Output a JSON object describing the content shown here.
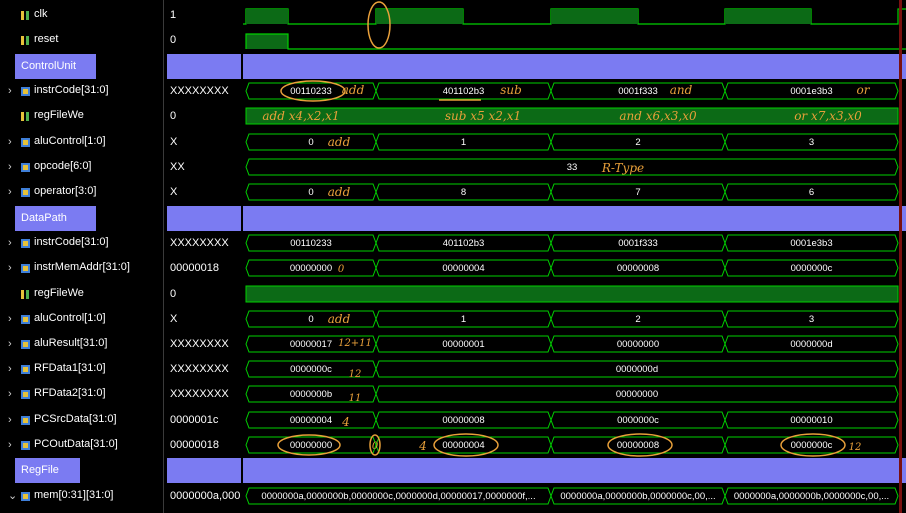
{
  "groups": {
    "control": "ControlUnit",
    "datapath": "DataPath",
    "regfile": "RegFile"
  },
  "signals": {
    "clk": "clk",
    "reset": "reset",
    "cu_instr": "instrCode[31:0]",
    "cu_regwe": "regFileWe",
    "cu_alu": "aluControl[1:0]",
    "cu_opcode": "opcode[6:0]",
    "cu_operator": "operator[3:0]",
    "dp_instr": "instrCode[31:0]",
    "dp_imem": "instrMemAddr[31:0]",
    "dp_regwe": "regFileWe",
    "dp_alu": "aluControl[1:0]",
    "dp_alures": "aluResult[31:0]",
    "dp_rf1": "RFData1[31:0]",
    "dp_rf2": "RFData2[31:0]",
    "dp_pcsrc": "PCSrcData[31:0]",
    "dp_pcout": "PCOutData[31:0]",
    "rf_mem": "mem[0:31][31:0]"
  },
  "values": {
    "clk": "1",
    "reset": "0",
    "cu_instr": "XXXXXXXX",
    "cu_regwe": "0",
    "cu_alu": "X",
    "cu_opcode": "XX",
    "cu_operator": "X",
    "dp_instr": "XXXXXXXX",
    "dp_imem": "00000018",
    "dp_regwe": "0",
    "dp_alu": "X",
    "dp_alures": "XXXXXXXX",
    "dp_rf1": "XXXXXXXX",
    "dp_rf2": "XXXXXXXX",
    "dp_pcsrc": "0000001c",
    "dp_pcout": "00000018",
    "rf_mem": "0000000a,000"
  },
  "wave": {
    "cu_instr": [
      "00110233",
      "401102b3",
      "0001f333",
      "0001e3b3"
    ],
    "cu_alu": [
      "0",
      "1",
      "2",
      "3"
    ],
    "cu_opcode": "33",
    "cu_operator": [
      "0",
      "8",
      "7",
      "6"
    ],
    "dp_instr": [
      "00110233",
      "401102b3",
      "0001f333",
      "0001e3b3"
    ],
    "dp_imem": [
      "00000000",
      "00000004",
      "00000008",
      "0000000c"
    ],
    "dp_alu": [
      "0",
      "1",
      "2",
      "3"
    ],
    "dp_alures": [
      "00000017",
      "00000001",
      "00000000",
      "0000000d"
    ],
    "dp_rf1": [
      "0000000c",
      "0000000d"
    ],
    "dp_rf2": [
      "0000000b",
      "00000000"
    ],
    "dp_pcsrc": [
      "00000004",
      "00000008",
      "0000000c",
      "00000010"
    ],
    "dp_pcout": [
      "00000000",
      "00000004",
      "00000008",
      "0000000c"
    ],
    "rf_mem": [
      "0000000a,0000000b,0000000c,0000000d,00000017,0000000f,...",
      "0000000a,0000000b,0000000c,00,...",
      "0000000a,0000000b,0000000c,00,..."
    ]
  },
  "annotations": {
    "add1": "add",
    "sub1": "sub",
    "and1": "and",
    "or1": "or",
    "asm_add": "add x4,x2,x1",
    "asm_sub": "sub x5 x2,x1",
    "asm_and": "and x6,x3,x0",
    "asm_or": "or x7,x3,x0",
    "alu_add": "add",
    "rtype": "R-Type",
    "op_add": "add",
    "imem_0": "0",
    "dp_alu_add": "add",
    "alures_12": "12+11",
    "rf1_12": "12",
    "rf2_11": "11",
    "pcsrc_4": "4",
    "pcout_0": "0",
    "pcout_4": "4",
    "pcout_12": "12"
  },
  "colors": {
    "wave": "#00d000",
    "group": "#7b7bf2",
    "annotation": "#e8a03a"
  }
}
